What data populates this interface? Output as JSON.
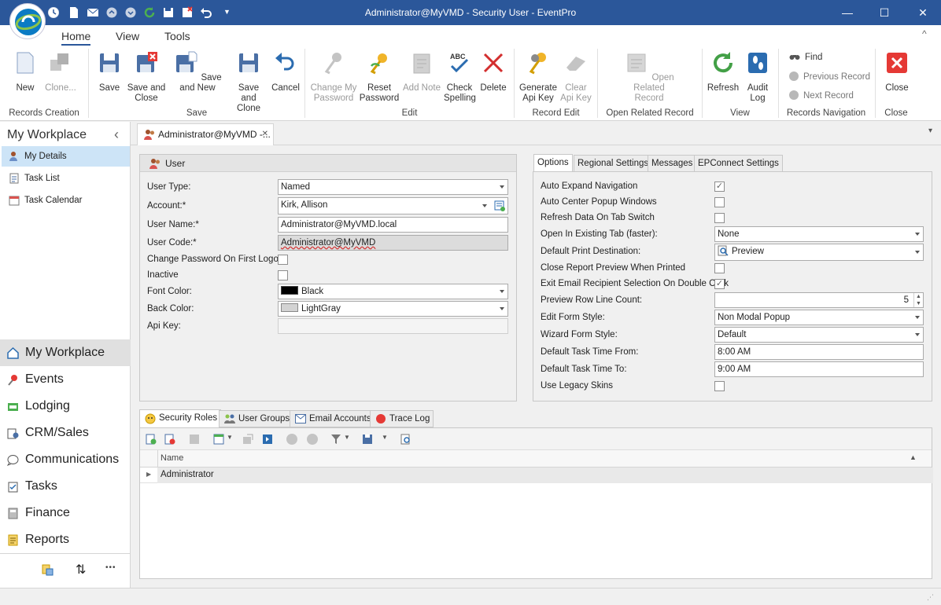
{
  "window": {
    "title": "Administrator@MyVMD - Security User - EventPro",
    "minimize_glyph": "—",
    "maximize_glyph": "☐",
    "close_glyph": "✕"
  },
  "ribbon": {
    "tabs": [
      {
        "label": "Home"
      },
      {
        "label": "View"
      },
      {
        "label": "Tools"
      }
    ],
    "collapse_glyph": "^",
    "buttons": {
      "new": "New",
      "clone": "Clone...",
      "save": "Save",
      "save_close": [
        "Save and",
        "Close"
      ],
      "save_new": "Save and New",
      "save_clone": [
        "Save and",
        "Clone"
      ],
      "cancel": "Cancel",
      "change_password": [
        "Change My",
        "Password"
      ],
      "reset_password": [
        "Reset",
        "Password"
      ],
      "add_note": "Add Note",
      "check_spelling": [
        "Check",
        "Spelling"
      ],
      "delete": "Delete",
      "generate_api_key": [
        "Generate",
        "Api Key"
      ],
      "clear_api_key": [
        "Clear",
        "Api Key"
      ],
      "open_related_record": [
        "Open Related",
        "Record"
      ],
      "refresh": "Refresh",
      "audit_log": [
        "Audit",
        "Log"
      ],
      "find": "Find",
      "previous_record": "Previous Record",
      "next_record": "Next Record",
      "close": "Close"
    },
    "groups": {
      "records_creation": "Records Creation",
      "save": "Save",
      "edit": "Edit",
      "record_edit": "Record Edit",
      "open_related_record": "Open Related Record",
      "view": "View",
      "records_navigation": "Records Navigation",
      "close": "Close"
    }
  },
  "workplace": {
    "title": "My Workplace",
    "collapse_glyph": "‹",
    "items": [
      {
        "label": "My Details",
        "selected": true
      },
      {
        "label": "Task List"
      },
      {
        "label": "Task Calendar"
      }
    ],
    "modules": [
      {
        "label": "My Workplace",
        "selected": true
      },
      {
        "label": "Events"
      },
      {
        "label": "Lodging"
      },
      {
        "label": "CRM/Sales"
      },
      {
        "label": "Communications"
      },
      {
        "label": "Tasks"
      },
      {
        "label": "Finance"
      },
      {
        "label": "Reports"
      }
    ],
    "footer": {
      "more_glyph": "•••",
      "reorder_glyph": "⇅"
    }
  },
  "doc_tab": {
    "label": "Administrator@MyVMD -...",
    "close_glyph": "✕",
    "menu_glyph": "▾"
  },
  "user_panel": {
    "title": "User",
    "fields": {
      "user_type": {
        "label": "User Type:",
        "value": "Named"
      },
      "account": {
        "label": "Account:*",
        "value": "Kirk, Allison"
      },
      "user_name": {
        "label": "User Name:*",
        "value": "Administrator@MyVMD.local"
      },
      "user_code": {
        "label": "User Code:*",
        "value": "Administrator@MyVMD"
      },
      "change_password": {
        "label": "Change Password On First Logon",
        "checked": false
      },
      "inactive": {
        "label": "Inactive",
        "checked": false
      },
      "font_color": {
        "label": "Font Color:",
        "value": "Black",
        "swatch": "#000000"
      },
      "back_color": {
        "label": "Back Color:",
        "value": "LightGray",
        "swatch": "#d3d3d3"
      },
      "api_key": {
        "label": "Api Key:",
        "value": ""
      }
    }
  },
  "options_panel": {
    "tabs": [
      {
        "label": "Options",
        "active": true
      },
      {
        "label": "Regional Settings"
      },
      {
        "label": "Messages"
      },
      {
        "label": "EPConnect Settings"
      }
    ],
    "check_glyph": "✓",
    "fields": {
      "auto_expand": {
        "label": "Auto Expand Navigation",
        "checked": true
      },
      "auto_center": {
        "label": "Auto Center Popup Windows",
        "checked": false
      },
      "refresh_tab": {
        "label": "Refresh Data On Tab Switch",
        "checked": false
      },
      "open_existing": {
        "label": "Open In Existing Tab (faster):",
        "value": "None"
      },
      "print_dest": {
        "label": "Default Print Destination:",
        "value": "Preview"
      },
      "close_preview": {
        "label": "Close Report Preview When Printed",
        "checked": false
      },
      "exit_email": {
        "label": "Exit Email Recipient Selection On Double Click",
        "checked": true
      },
      "row_count": {
        "label": "Preview Row Line Count:",
        "value": "5"
      },
      "edit_form": {
        "label": "Edit Form Style:",
        "value": "Non Modal Popup"
      },
      "wizard_form": {
        "label": "Wizard Form Style:",
        "value": "Default"
      },
      "task_from": {
        "label": "Default Task Time From:",
        "value": "8:00 AM"
      },
      "task_to": {
        "label": "Default Task Time To:",
        "value": "9:00 AM"
      },
      "legacy_skins": {
        "label": "Use Legacy Skins",
        "checked": false
      }
    }
  },
  "bottom_tabs": [
    {
      "label": "Security Roles",
      "active": true
    },
    {
      "label": "User Groups"
    },
    {
      "label": "Email Accounts"
    },
    {
      "label": "Trace Log"
    }
  ],
  "grid": {
    "columns": [
      {
        "label": "Name"
      }
    ],
    "rows": [
      {
        "name": "Administrator"
      }
    ]
  },
  "colors": {
    "titlebar": "#2b579a",
    "selection": "#cde4f7"
  }
}
